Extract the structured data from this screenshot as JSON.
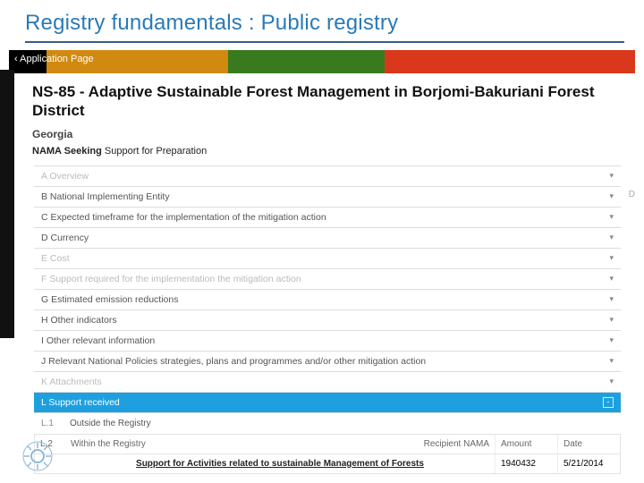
{
  "slide": {
    "title": "Registry fundamentals : Public registry"
  },
  "breadcrumb": "‹ Application Page",
  "record": {
    "title": "NS-85 - Adaptive Sustainable Forest Management in Borjomi-Bakuriani Forest District",
    "country": "Georgia",
    "section_prefix": "NAMA Seeking",
    "section_rest": " Support for Preparation"
  },
  "accordion": [
    {
      "id": "A",
      "label": "A Overview",
      "dim": true
    },
    {
      "id": "B",
      "label": "B National Implementing Entity",
      "dim": false
    },
    {
      "id": "C",
      "label": "C Expected timeframe for the implementation of the mitigation action",
      "dim": false
    },
    {
      "id": "D",
      "label": "D Currency",
      "dim": false
    },
    {
      "id": "E",
      "label": "E Cost",
      "dim": true
    },
    {
      "id": "F",
      "label": "F Support required for the implementation the mitigation action",
      "dim": true
    },
    {
      "id": "G",
      "label": "G Estimated emission reductions",
      "dim": false
    },
    {
      "id": "H",
      "label": "H Other indicators",
      "dim": false
    },
    {
      "id": "I",
      "label": "I Other relevant information",
      "dim": false
    },
    {
      "id": "J",
      "label": "J Relevant National Policies strategies, plans and programmes and/or other mitigation action",
      "dim": false
    },
    {
      "id": "K",
      "label": "K Attachments",
      "dim": true
    }
  ],
  "active_section": {
    "label": "L Support received"
  },
  "subrows": {
    "l1": {
      "num": "L.1",
      "label": "Outside the Registry"
    },
    "l2": {
      "num": "L.2",
      "label": "Within the Registry"
    }
  },
  "table": {
    "headers": {
      "recipient": "Recipient NAMA",
      "amount": "Amount",
      "date": "Date"
    },
    "row": {
      "link": "Support for Activities related to sustainable Management of Forests",
      "amount": "1940432",
      "date": "5/21/2014"
    }
  },
  "right_badge": "D"
}
